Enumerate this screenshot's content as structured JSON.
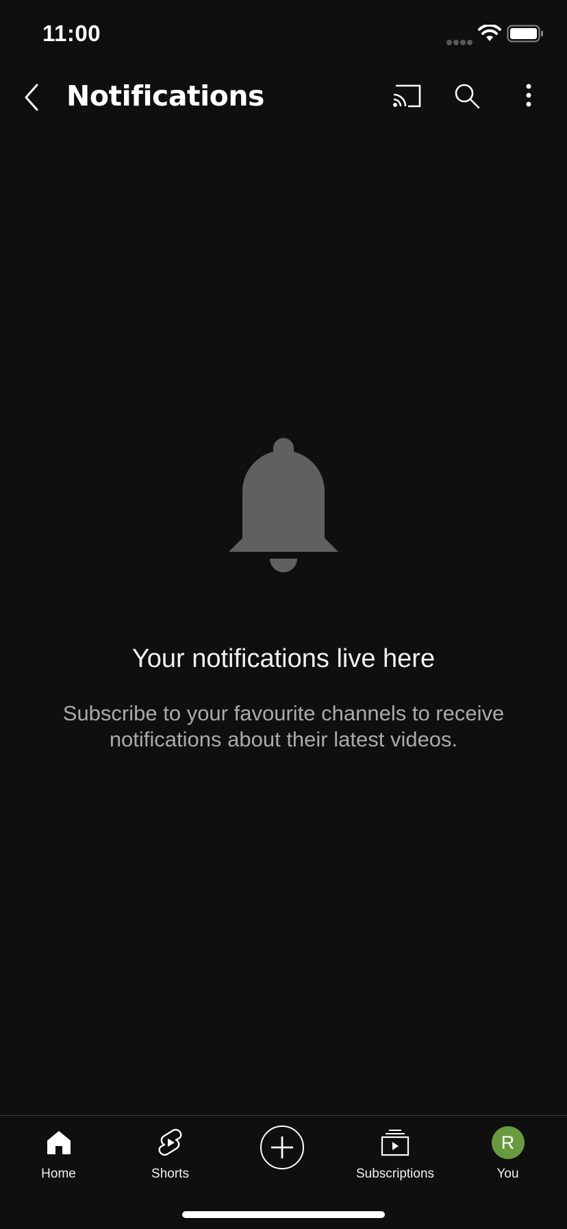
{
  "status_bar": {
    "time": "11:00"
  },
  "header": {
    "title": "Notifications"
  },
  "empty_state": {
    "title": "Your notifications live here",
    "body": "Subscribe to your favourite channels to receive notifications about their latest videos."
  },
  "bottom_nav": {
    "items": [
      {
        "label": "Home",
        "icon": "home-icon"
      },
      {
        "label": "Shorts",
        "icon": "shorts-icon"
      },
      {
        "label": "",
        "icon": "create-icon"
      },
      {
        "label": "Subscriptions",
        "icon": "subscriptions-icon"
      },
      {
        "label": "You",
        "icon": "avatar"
      }
    ],
    "avatar_letter": "R"
  },
  "colors": {
    "background": "#0f0f0f",
    "bell": "#606060",
    "avatar": "#6a9a3f",
    "secondary_text": "#aaaaaa"
  }
}
